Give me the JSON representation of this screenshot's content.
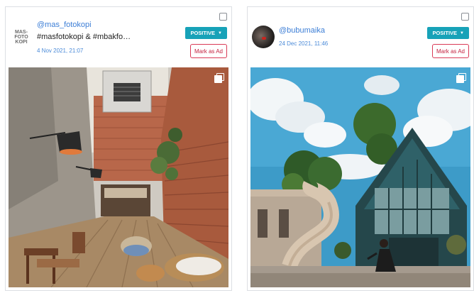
{
  "posts": [
    {
      "username": "@mas_fotokopi",
      "caption": "#masfotokopi & #mbakfo…",
      "timestamp": "4 Nov 2021, 21:07",
      "sentiment": "POSITIVE",
      "mark_ad": "Mark as Ad",
      "avatar_logo": "MAS- FOTO KOPI",
      "icons": {
        "avatar": "brand-logo",
        "multi": "multiple-images-icon",
        "dropdown": "caret-down-icon"
      }
    },
    {
      "username": "@bubumaika",
      "caption": "",
      "timestamp": "24 Dec 2021, 11:46",
      "sentiment": "POSITIVE",
      "mark_ad": "Mark as Ad",
      "icons": {
        "avatar": "user-photo",
        "multi": "multiple-images-icon",
        "dropdown": "caret-down-icon"
      }
    }
  ],
  "colors": {
    "username": "#3c7ed6",
    "sentiment_bg": "#17a2b8",
    "mark_ad_border": "#d93a56",
    "timestamp": "#4a8ad8"
  }
}
